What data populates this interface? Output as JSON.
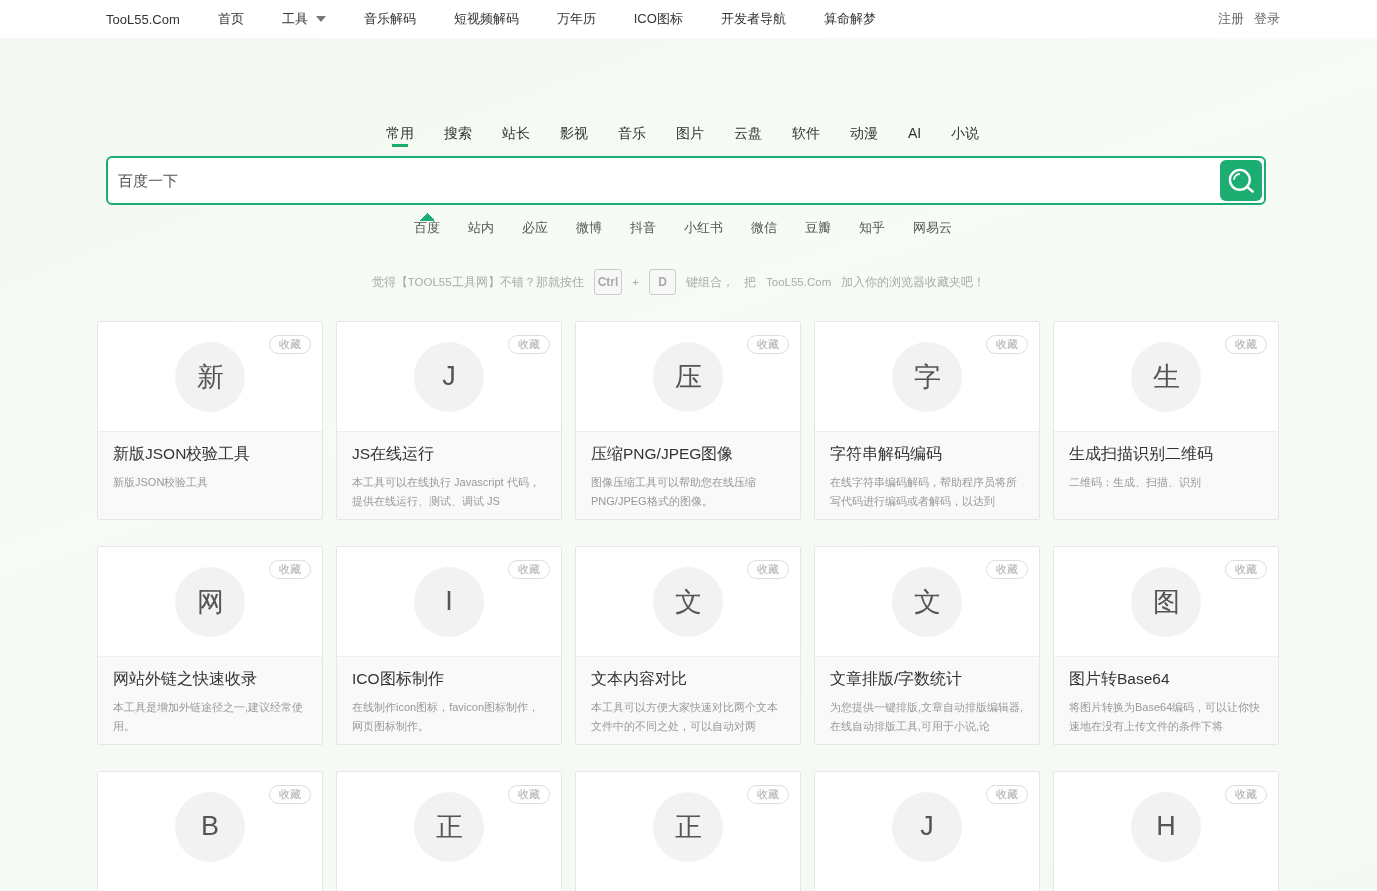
{
  "header": {
    "logo": "TooL55.Com",
    "nav": [
      {
        "label": "首页",
        "dropdown": false
      },
      {
        "label": "工具",
        "dropdown": true
      },
      {
        "label": "音乐解码",
        "dropdown": false
      },
      {
        "label": "短视频解码",
        "dropdown": false
      },
      {
        "label": "万年历",
        "dropdown": false
      },
      {
        "label": "ICO图标",
        "dropdown": false
      },
      {
        "label": "开发者导航",
        "dropdown": false
      },
      {
        "label": "算命解梦",
        "dropdown": false
      }
    ],
    "account": [
      "注册",
      "登录"
    ]
  },
  "search": {
    "categories": [
      {
        "label": "常用",
        "selected": true
      },
      {
        "label": "搜索",
        "selected": false
      },
      {
        "label": "站长",
        "selected": false
      },
      {
        "label": "影视",
        "selected": false
      },
      {
        "label": "音乐",
        "selected": false
      },
      {
        "label": "图片",
        "selected": false
      },
      {
        "label": "云盘",
        "selected": false
      },
      {
        "label": "软件",
        "selected": false
      },
      {
        "label": "动漫",
        "selected": false
      },
      {
        "label": "AI",
        "selected": false
      },
      {
        "label": "小说",
        "selected": false
      }
    ],
    "placeholder": "百度一下",
    "engines": [
      {
        "label": "百度",
        "selected": true
      },
      {
        "label": "站内",
        "selected": false
      },
      {
        "label": "必应",
        "selected": false
      },
      {
        "label": "微博",
        "selected": false
      },
      {
        "label": "抖音",
        "selected": false
      },
      {
        "label": "小红书",
        "selected": false
      },
      {
        "label": "微信",
        "selected": false
      },
      {
        "label": "豆瓣",
        "selected": false
      },
      {
        "label": "知乎",
        "selected": false
      },
      {
        "label": "网易云",
        "selected": false
      }
    ]
  },
  "hint": {
    "before": "觉得【TOOL55工具网】不错？那就按住",
    "keys": [
      "Ctrl",
      "+",
      "D"
    ],
    "middle": "键组合，",
    "ba": "把",
    "site": "TooL55.Com",
    "after": "加入你的浏览器收藏夹吧！"
  },
  "tools": [
    {
      "letter": "新",
      "badge": "收藏",
      "title": "新版JSON校验工具",
      "desc": "新版JSON校验工具"
    },
    {
      "letter": "J",
      "badge": "收藏",
      "title": "JS在线运行",
      "desc": "本工具可以在线执行 Javascript 代码，提供在线运行、测试、调试 JS"
    },
    {
      "letter": "压",
      "badge": "收藏",
      "title": "压缩PNG/JPEG图像",
      "desc": "图像压缩工具可以帮助您在线压缩PNG/JPEG格式的图像。"
    },
    {
      "letter": "字",
      "badge": "收藏",
      "title": "字符串解码编码",
      "desc": "在线字符串编码解码，帮助程序员将所写代码进行编码或者解码，以达到"
    },
    {
      "letter": "生",
      "badge": "收藏",
      "title": "生成扫描识别二维码",
      "desc": "二维码：生成、扫描、识别"
    },
    {
      "letter": "网",
      "badge": "收藏",
      "title": "网站外链之快速收录",
      "desc": "本工具是增加外链途径之一,建议经常使用。"
    },
    {
      "letter": "I",
      "badge": "收藏",
      "title": "ICO图标制作",
      "desc": "在线制作icon图标，favicon图标制作，网页图标制作。"
    },
    {
      "letter": "文",
      "badge": "收藏",
      "title": "文本内容对比",
      "desc": "本工具可以方便大家快速对比两个文本文件中的不同之处，可以自动对两"
    },
    {
      "letter": "文",
      "badge": "收藏",
      "title": "文章排版/字数统计",
      "desc": "为您提供一键排版,文章自动排版编辑器,在线自动排版工具,可用于小说,论"
    },
    {
      "letter": "图",
      "badge": "收藏",
      "title": "图片转Base64",
      "desc": "将图片转换为Base64编码，可以让你快速地在没有上传文件的条件下将"
    },
    {
      "letter": "B",
      "badge": "收藏"
    },
    {
      "letter": "正",
      "badge": "收藏"
    },
    {
      "letter": "正",
      "badge": "收藏"
    },
    {
      "letter": "J",
      "badge": "收藏"
    },
    {
      "letter": "H",
      "badge": "收藏"
    }
  ]
}
